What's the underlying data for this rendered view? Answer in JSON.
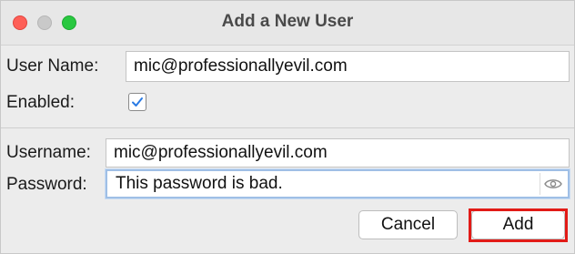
{
  "window": {
    "title": "Add a New User"
  },
  "form": {
    "user_name_label": "User Name:",
    "user_name_value": "mic@professionallyevil.com",
    "enabled_label": "Enabled:",
    "enabled_checked": true,
    "username_label": "Username:",
    "username_value": "mic@professionallyevil.com",
    "password_label": "Password:",
    "password_value": "This password is bad."
  },
  "buttons": {
    "cancel_label": "Cancel",
    "add_label": "Add"
  },
  "colors": {
    "checkbox_accent": "#2a7be4",
    "highlight_border": "#e21b17"
  },
  "icons": {
    "password_toggle": "eye-icon"
  }
}
